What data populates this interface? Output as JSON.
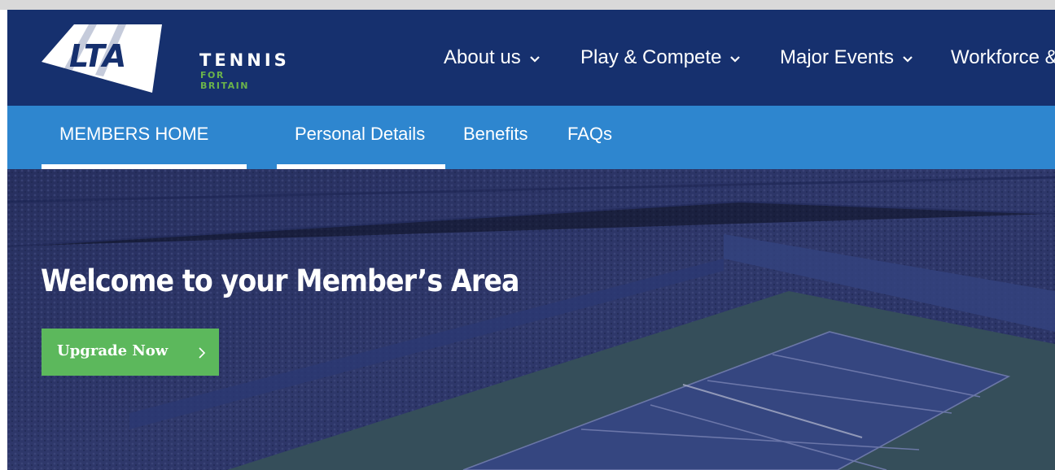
{
  "brand": {
    "logo_mark": "LTA",
    "line1": "TENNIS",
    "line2": "FOR BRITAIN",
    "accent_green": "#6bb34a"
  },
  "colors": {
    "header_bg": "#16306e",
    "subnav_bg": "#2e86cf",
    "button_bg": "#5cb85c",
    "hero_overlay": "#2b3568"
  },
  "main_nav": {
    "items": [
      {
        "label": "About us",
        "icon": "chevron-down-icon"
      },
      {
        "label": "Play & Compete",
        "icon": "chevron-down-icon"
      },
      {
        "label": "Major Events",
        "icon": "chevron-down-icon"
      },
      {
        "label": "Workforce &",
        "icon": ""
      }
    ]
  },
  "sub_nav": {
    "items": [
      {
        "label": "MEMBERS HOME",
        "active": true
      },
      {
        "label": "Personal Details",
        "active": true
      },
      {
        "label": "Benefits",
        "active": false
      },
      {
        "label": "FAQs",
        "active": false
      }
    ]
  },
  "hero": {
    "title": "Welcome to your Member’s Area",
    "button_label": "Upgrade Now",
    "button_icon": "chevron-right-icon",
    "background": "tennis stadium photo"
  }
}
